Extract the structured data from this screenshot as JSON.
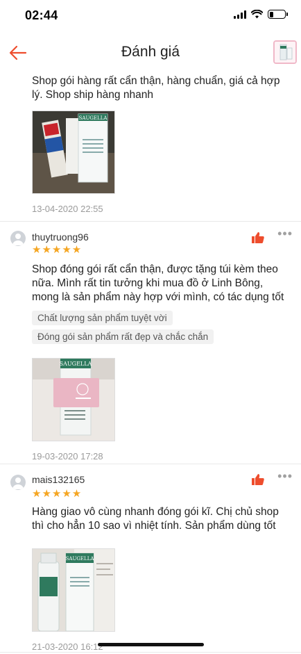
{
  "status": {
    "time": "02:44",
    "battery_level": 0.25
  },
  "header": {
    "title": "Đánh giá",
    "back_icon": "arrow-left-icon"
  },
  "reviews": [
    {
      "text": "Shop gói hàng rất cẩn thận, hàng chuẩn, giá cả hợp lý. Shop ship hàng nhanh",
      "photo_text": "SAUGELLA",
      "date": "13-04-2020 22:55"
    },
    {
      "username": "thuytruong96",
      "stars": "★★★★★",
      "text": "Shop đóng gói rất cẩn thận, được tặng túi kèm theo nữa. Mình rất tin tưởng khi mua đồ ở Linh Bông, mong là sản phẩm này hợp với mình, có tác dụng tốt",
      "tags": [
        "Chất lượng sản phẩm tuyệt vời",
        "Đóng gói sản phẩm rất đẹp và chắc chắn"
      ],
      "photo_text": "SAUGELLA",
      "date": "19-03-2020 17:28"
    },
    {
      "username": "mais132165",
      "stars": "★★★★★",
      "text": "Hàng giao vô cùng nhanh đóng gói kĩ. Chị chủ shop thì cho hẳn 10 sao vì nhiệt tính. Sản phẩm dùng tốt",
      "photo_text": "SAUGELLA",
      "date": "21-03-2020 16:12"
    }
  ],
  "colors": {
    "accent": "#ee4d2d",
    "star": "#f5a623",
    "date": "#9b9b9b"
  }
}
